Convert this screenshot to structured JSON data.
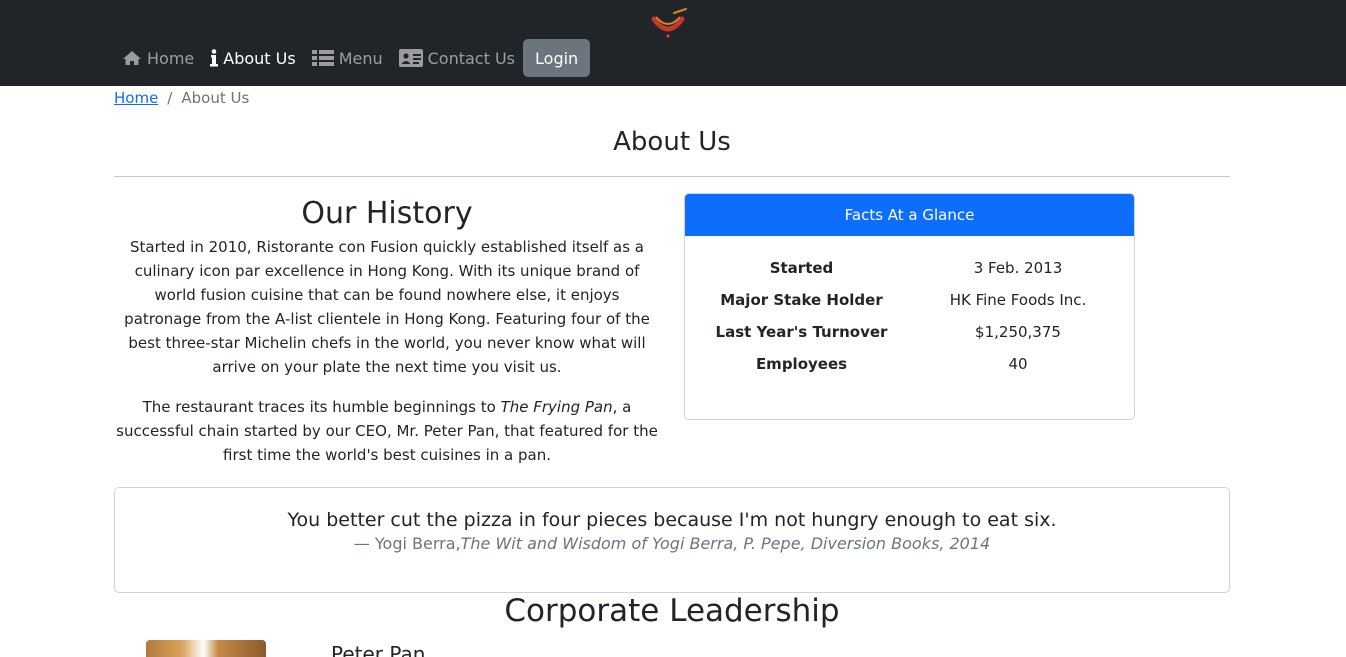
{
  "nav": {
    "brand_icon": "restaurant-logo",
    "items": [
      {
        "label": "Home",
        "icon": "home-icon"
      },
      {
        "label": "About Us",
        "icon": "info-icon"
      },
      {
        "label": "Menu",
        "icon": "list-icon"
      },
      {
        "label": "Contact Us",
        "icon": "address-card-icon"
      }
    ],
    "login_label": "Login"
  },
  "breadcrumb": {
    "home": "Home",
    "separator": "/",
    "current": "About Us"
  },
  "page_title": "About Us",
  "history": {
    "title": "Our History",
    "p1": "Started in 2010, Ristorante con Fusion quickly established itself as a culinary icon par excellence in Hong Kong. With its unique brand of world fusion cuisine that can be found nowhere else, it enjoys patronage from the A-list clientele in Hong Kong. Featuring four of the best three-star Michelin chefs in the world, you never know what will arrive on your plate the next time you visit us.",
    "p2_before": "The restaurant traces its humble beginnings to ",
    "p2_italic": "The Frying Pan",
    "p2_after": ", a successful chain started by our CEO, Mr. Peter Pan, that featured for the first time the world's best cuisines in a pan."
  },
  "facts": {
    "header": "Facts At a Glance",
    "rows": [
      {
        "key": "Started",
        "value": "3 Feb. 2013"
      },
      {
        "key": "Major Stake Holder",
        "value": "HK Fine Foods Inc."
      },
      {
        "key": "Last Year's Turnover",
        "value": "$1,250,375"
      },
      {
        "key": "Employees",
        "value": "40"
      }
    ]
  },
  "quote": {
    "text": "You better cut the pizza in four pieces because I'm not hungry enough to eat six.",
    "author": "— Yogi Berra,",
    "source": "The Wit and Wisdom of Yogi Berra, P. Pepe, Diversion Books, 2014"
  },
  "leadership": {
    "title": "Corporate Leadership",
    "first_name": "Peter Pan"
  },
  "colors": {
    "navbar_bg": "#212529",
    "primary": "#0d6efd",
    "secondary": "#6c757d"
  }
}
